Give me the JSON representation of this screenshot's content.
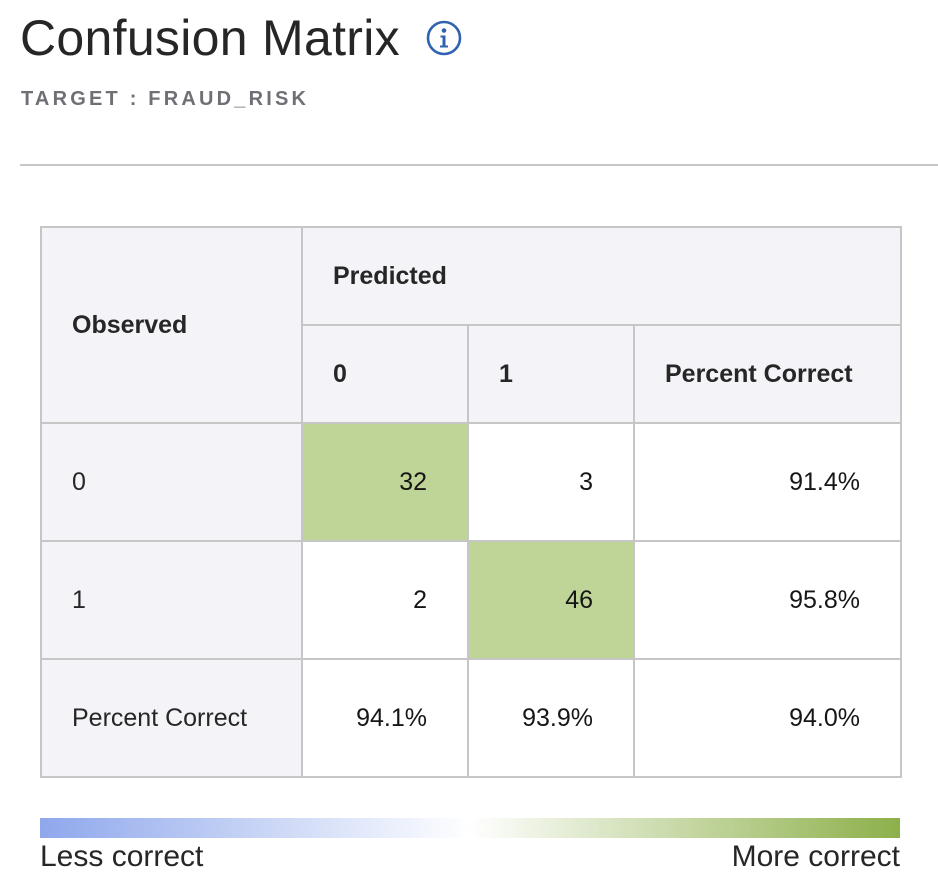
{
  "header": {
    "title": "Confusion Matrix",
    "subtitle": "TARGET : FRAUD_RISK",
    "info_icon": "info-icon"
  },
  "matrix": {
    "observed_label": "Observed",
    "predicted_label": "Predicted",
    "columns": [
      "0",
      "1",
      "Percent Correct"
    ],
    "rows": [
      {
        "label": "0",
        "cells": [
          "32",
          "3",
          "91.4%"
        ],
        "highlight_index": 0
      },
      {
        "label": "1",
        "cells": [
          "2",
          "46",
          "95.8%"
        ],
        "highlight_index": 1
      },
      {
        "label": "Percent Correct",
        "cells": [
          "94.1%",
          "93.9%",
          "94.0%"
        ],
        "highlight_index": -1
      }
    ]
  },
  "legend": {
    "left_label": "Less correct",
    "right_label": "More correct",
    "colors": {
      "low": "#8fa8ec",
      "mid": "#ffffff",
      "high": "#8db04a",
      "cell_highlight": "#bfd597"
    }
  }
}
